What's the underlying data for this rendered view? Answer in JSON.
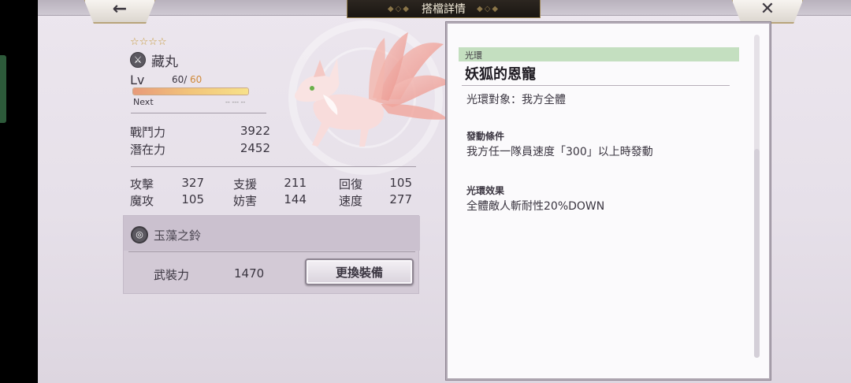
{
  "header": {
    "title": "搭檔詳情",
    "back_icon": "←",
    "close_icon": "✕"
  },
  "character": {
    "stars": "☆☆☆☆",
    "name": "藏丸",
    "lv_label": "Lv",
    "level": "60/",
    "level_max": "60",
    "exp_fraction": 1.0,
    "next_label": "Next",
    "next_value": "-- --- --",
    "combat_power_label": "戰鬥力",
    "combat_power": "3922",
    "potential_label": "潛在力",
    "potential": "2452"
  },
  "stats": {
    "attack_label": "攻擊",
    "attack": "327",
    "support_label": "支援",
    "support": "211",
    "recovery_label": "回復",
    "recovery": "105",
    "magic_label": "魔攻",
    "magic": "105",
    "obstruct_label": "妨害",
    "obstruct": "144",
    "speed_label": "速度",
    "speed": "277"
  },
  "equipment": {
    "name": "玉藻之鈴",
    "power_label": "武裝力",
    "power": "1470",
    "change_button": "更換裝備"
  },
  "aura": {
    "tag": "光環",
    "title": "妖狐的恩寵",
    "target_text": "光環對象：我方全體",
    "condition_heading": "發動條件",
    "condition_text": "我方任一隊員速度「300」以上時發動",
    "effect_heading": "光環效果",
    "effect_text": "全體敵人斬耐性20%DOWN"
  },
  "colors": {
    "aura_band": "#c4dfc0",
    "level_max": "#d08a3a",
    "title_plate": "#1a1612"
  }
}
